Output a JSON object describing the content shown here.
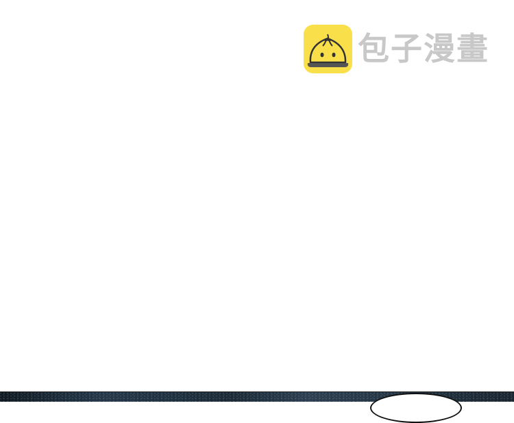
{
  "watermark": {
    "logo_icon": "steamed-bun-icon",
    "brand_text": "包子漫畫",
    "colors": {
      "badge": "#f9e04a",
      "text": "#c8c8c8",
      "outline": "#333333"
    }
  }
}
